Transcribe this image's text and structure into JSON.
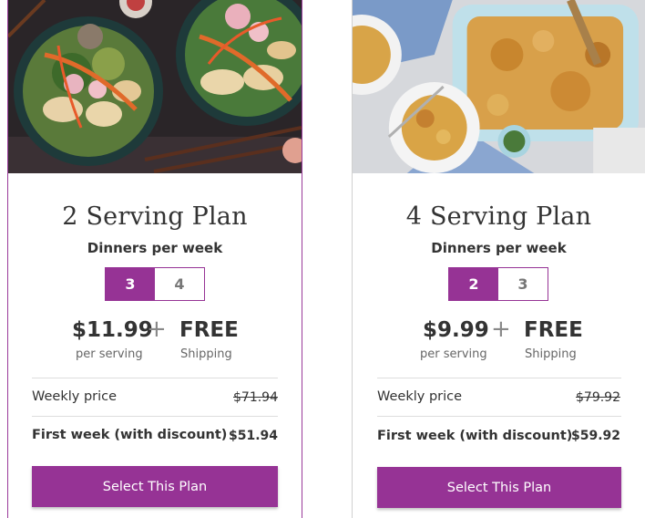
{
  "colors": {
    "accent": "#963395"
  },
  "plans": [
    {
      "title": "2 Serving Plan",
      "subtitle": "Dinners per week",
      "options": [
        "3",
        "4"
      ],
      "selected": "3",
      "price": "$11.99",
      "price_sub": "per serving",
      "plus": "+",
      "shipping": "FREE",
      "shipping_sub": "Shipping",
      "weekly_label": "Weekly price",
      "weekly_value": "$71.94",
      "first_week_label": "First week (with discount)",
      "first_week_value": "$51.94",
      "button": "Select This Plan"
    },
    {
      "title": "4 Serving Plan",
      "subtitle": "Dinners per week",
      "options": [
        "2",
        "3"
      ],
      "selected": "2",
      "price": "$9.99",
      "price_sub": "per serving",
      "plus": "+",
      "shipping": "FREE",
      "shipping_sub": "Shipping",
      "weekly_label": "Weekly price",
      "weekly_value": "$79.92",
      "first_week_label": "First week (with discount)",
      "first_week_value": "$59.92",
      "button": "Select This Plan"
    }
  ]
}
